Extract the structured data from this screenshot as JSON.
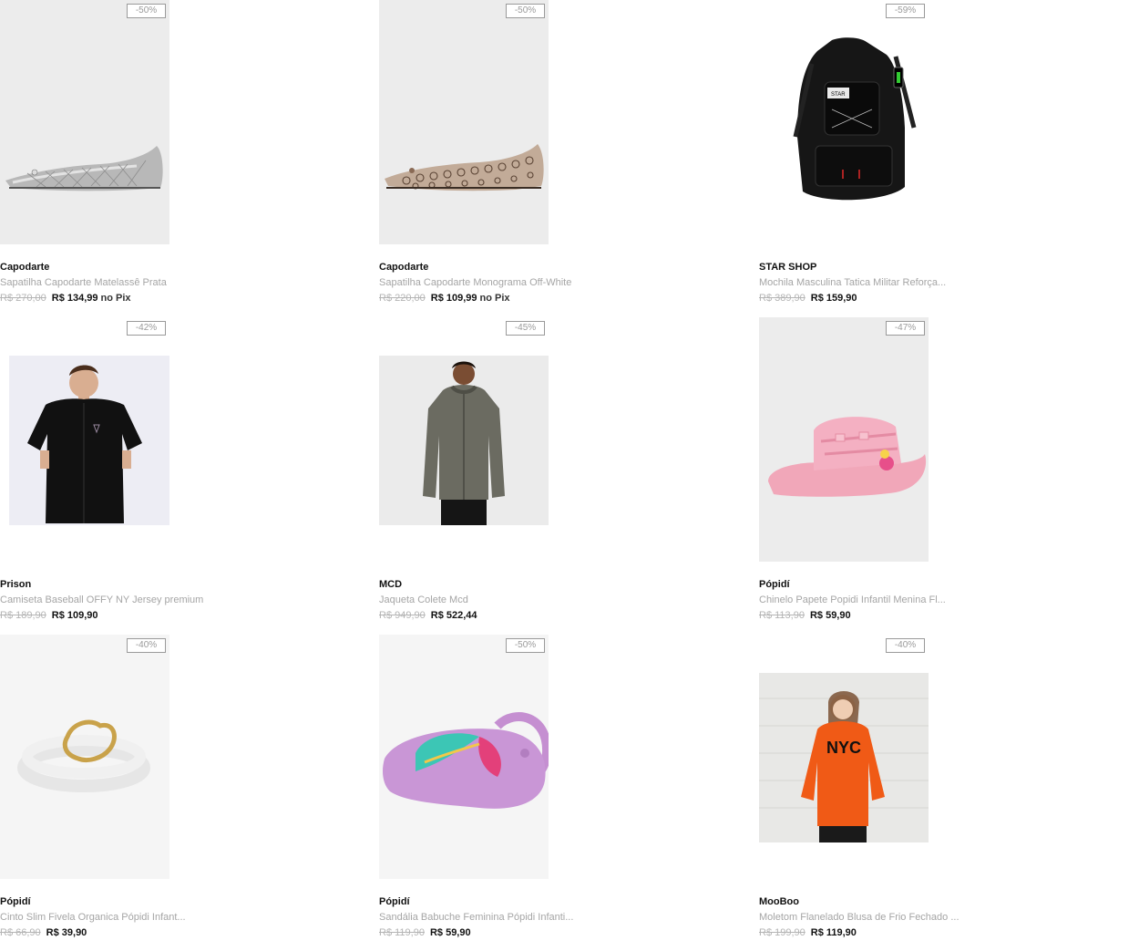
{
  "products": [
    {
      "brand": "Capodarte",
      "name": "Sapatilha Capodarte Matelassê Prata",
      "old_price": "R$ 270,00",
      "price": "R$ 134,99",
      "pix": "no Pix",
      "discount": "-50%",
      "image": "silver-ballet-flat"
    },
    {
      "brand": "Capodarte",
      "name": "Sapatilha Capodarte Monograma Off-White",
      "old_price": "R$ 220,00",
      "price": "R$ 109,99",
      "pix": "no Pix",
      "discount": "-50%",
      "image": "monogram-ballet-flat"
    },
    {
      "brand": "STAR SHOP",
      "name": "Mochila Masculina Tatica Militar Reforça...",
      "old_price": "R$ 389,90",
      "price": "R$ 159,90",
      "pix": "",
      "discount": "-59%",
      "image": "black-tactical-backpack"
    },
    {
      "brand": "Prison",
      "name": "Camiseta Baseball OFFY NY Jersey premium",
      "old_price": "R$ 189,90",
      "price": "R$ 109,90",
      "pix": "",
      "discount": "-42%",
      "image": "black-jersey-shirt"
    },
    {
      "brand": "MCD",
      "name": "Jaqueta Colete Mcd",
      "old_price": "R$ 949,90",
      "price": "R$ 522,44",
      "pix": "",
      "discount": "-45%",
      "image": "gray-hooded-jacket"
    },
    {
      "brand": "Pópidí",
      "name": "Chinelo Papete Popidi Infantil Menina Fl...",
      "old_price": "R$ 113,90",
      "price": "R$ 59,90",
      "pix": "",
      "discount": "-47%",
      "image": "pink-slide-sandal"
    },
    {
      "brand": "Pópidí",
      "name": "Cinto Slim Fivela Organica Pópidi Infant...",
      "old_price": "R$ 66,90",
      "price": "R$ 39,90",
      "pix": "",
      "discount": "-40%",
      "image": "white-belt-gold-buckle"
    },
    {
      "brand": "Pópidí",
      "name": "Sandália Babuche Feminina Pópidi Infanti...",
      "old_price": "R$ 119,90",
      "price": "R$ 59,90",
      "pix": "",
      "discount": "-50%",
      "image": "lilac-butterfly-clog"
    },
    {
      "brand": "MooBoo",
      "name": "Moletom Flanelado Blusa de Frio Fechado ...",
      "old_price": "R$ 199,90",
      "price": "R$ 119,90",
      "pix": "",
      "discount": "-40%",
      "image": "orange-nyc-hoodie"
    }
  ]
}
